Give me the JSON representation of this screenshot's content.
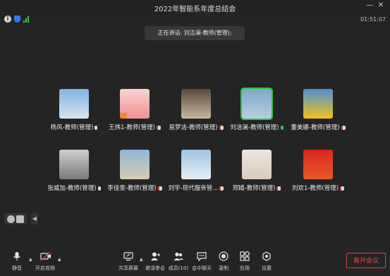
{
  "window": {
    "title": "2022年智能系年度总结会",
    "minimize": "—",
    "close": "✕"
  },
  "status": {
    "clock": "01:51:07",
    "info_icon": "info-icon",
    "shield_color": "#2e7cf6",
    "signal_color": "#3cc14a"
  },
  "speaking": {
    "text": "正在讲话: 刘洁澜-教师(管理);"
  },
  "participants": [
    {
      "name": "杨风-教师(管理)",
      "mic": "white",
      "avatar_colors": [
        "#7fb2e6",
        "#d8e4ee"
      ]
    },
    {
      "name": "王炜1-教师(管理)",
      "mic": "red",
      "avatar_colors": [
        "#f7d4d4",
        "#f28f8f"
      ],
      "badge": true
    },
    {
      "name": "易梦洁-教师(管理)",
      "mic": "red",
      "avatar_colors": [
        "#5a4a3a",
        "#c8b8a0"
      ]
    },
    {
      "name": "刘洁澜-教师(管理)",
      "mic": "green",
      "avatar_colors": [
        "#7fa8c9",
        "#b7cfe0"
      ],
      "active": true
    },
    {
      "name": "董美娜-教师(管理)",
      "mic": "red",
      "avatar_colors": [
        "#4c8fd6",
        "#f2c21b"
      ]
    },
    {
      "name": "张威加-教师(管理)",
      "mic": "white",
      "avatar_colors": [
        "#cfcfcf",
        "#7a7a7a"
      ]
    },
    {
      "name": "李佳雯-教师(管理)",
      "mic": "red",
      "avatar_colors": [
        "#8fb8d8",
        "#d8cbb0"
      ]
    },
    {
      "name": "刘宇-现代服务管...",
      "mic": "red",
      "avatar_colors": [
        "#9cc6e6",
        "#e8eef2"
      ]
    },
    {
      "name": "郑婧-教师(管理)",
      "mic": "red",
      "avatar_colors": [
        "#ece6df",
        "#d9cbbb"
      ]
    },
    {
      "name": "刘欢1-教师(管理)",
      "mic": "red",
      "avatar_colors": [
        "#d8261c",
        "#e85a2a"
      ]
    }
  ],
  "toolbar": {
    "mute": "静音",
    "video": "开启视频",
    "share": "共享屏幕",
    "invite": "邀请参会",
    "members": "成员(10)",
    "chat": "会中聊天",
    "record": "录制",
    "apps": "应用",
    "settings": "设置",
    "leave": "离开会议"
  }
}
